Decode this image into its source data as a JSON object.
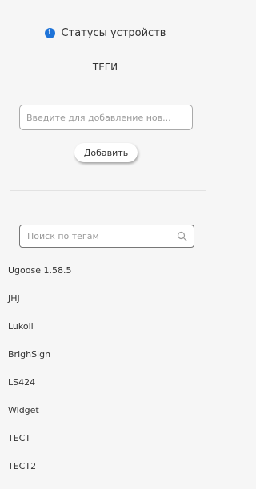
{
  "status": {
    "icon": "info-icon",
    "label": "Статусы устройств"
  },
  "tags_section": {
    "title": "ТЕГИ",
    "add_input": {
      "placeholder": "Введите для добавление нов...",
      "value": ""
    },
    "add_button_label": "Добавить"
  },
  "search": {
    "placeholder": "Поиск по тегам",
    "value": "",
    "icon": "search-icon"
  },
  "tags": [
    "Ugoose 1.58.5",
    "JHJ",
    "Lukoil",
    "BrighSign",
    "LS424",
    "Widget",
    "ТЕСТ",
    "ТЕСТ2"
  ],
  "colors": {
    "accent": "#1e73d8",
    "background": "#f6f6f6"
  }
}
